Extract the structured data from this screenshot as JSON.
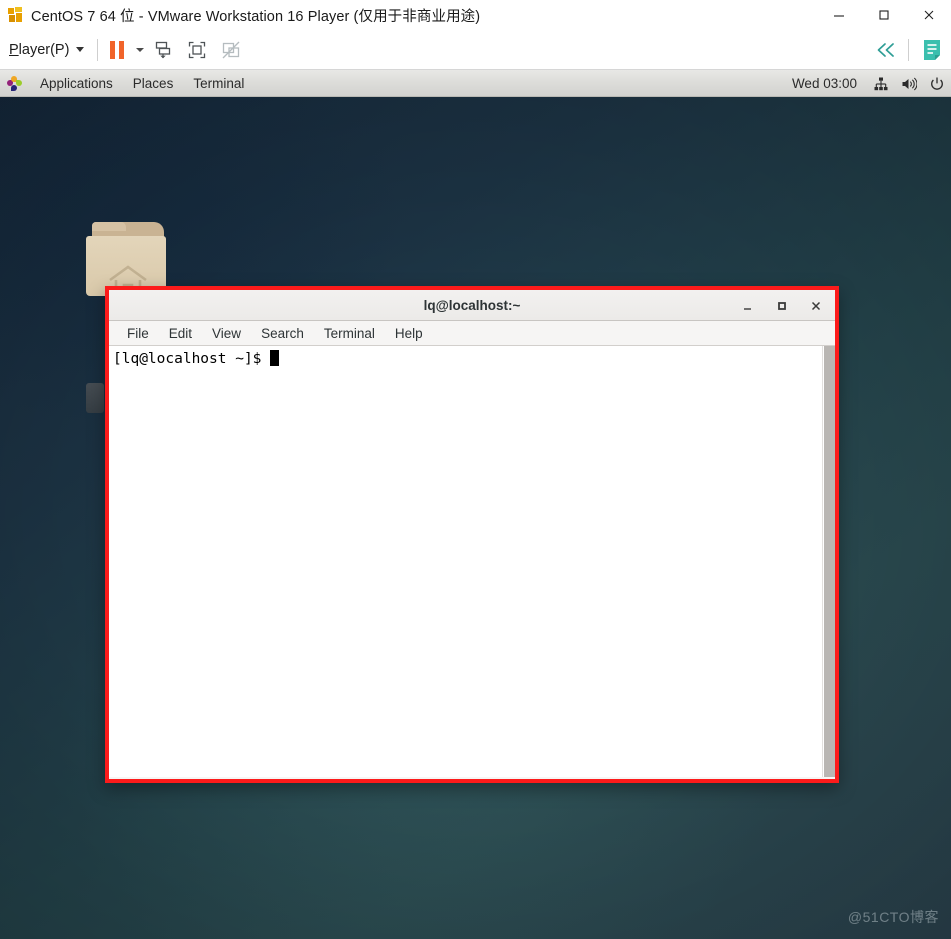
{
  "vmware": {
    "title": "CentOS 7 64 位 - VMware Workstation 16 Player (仅用于非商业用途)",
    "app_icon": "vmware-logo-icon",
    "window_controls": [
      {
        "name": "minimize-button",
        "label": "Minimize",
        "glyph": "minimize-icon"
      },
      {
        "name": "maximize-button",
        "label": "Maximize",
        "glyph": "maximize-icon"
      },
      {
        "name": "close-button",
        "label": "Close",
        "glyph": "close-icon"
      }
    ],
    "toolbar": {
      "player_menu_label": "Player(P)",
      "player_menu_accesskey": "P",
      "pause_button_name": "pause-vm-button",
      "pause_color": "#f1642a",
      "icons": [
        {
          "name": "send-ctrl-alt-del-icon",
          "label": "Send Ctrl+Alt+Del"
        },
        {
          "name": "enter-fullscreen-icon",
          "label": "Enter full screen"
        },
        {
          "name": "unity-mode-disabled-icon",
          "label": "Unity mode (disabled)"
        }
      ],
      "right_icons": [
        {
          "name": "collapse-toolbar-icon",
          "label": "Collapse",
          "color": "#2f9e96"
        },
        {
          "name": "notes-icon",
          "label": "Notes",
          "color": "#3bbfae"
        }
      ]
    }
  },
  "guest": {
    "panel": {
      "logo_icon": "centos-logo-icon",
      "menus": [
        {
          "name": "applications-menu",
          "label": "Applications"
        },
        {
          "name": "places-menu",
          "label": "Places"
        },
        {
          "name": "terminal-window-menu",
          "label": "Terminal"
        }
      ],
      "clock": "Wed 03:00",
      "status_icons": [
        {
          "name": "network-icon",
          "label": "Network"
        },
        {
          "name": "volume-icon",
          "label": "Volume"
        },
        {
          "name": "power-icon",
          "label": "Power / System"
        }
      ]
    },
    "desktop": {
      "icons": [
        {
          "name": "desktop-icon-home",
          "label": "Home folder",
          "color": "#ddcfb1"
        }
      ],
      "watermark": "@51CTO博客",
      "background_colors": [
        "#16293c",
        "#24444c",
        "#2c4450"
      ]
    }
  },
  "terminal": {
    "title": "lq@localhost:~",
    "highlight_border_color": "#fc1b1b",
    "window_controls": [
      {
        "name": "terminal-minimize-button",
        "label": "Minimize"
      },
      {
        "name": "terminal-maximize-button",
        "label": "Maximize"
      },
      {
        "name": "terminal-close-button",
        "label": "Close"
      }
    ],
    "menus": [
      {
        "name": "terminal-menu-file",
        "label": "File"
      },
      {
        "name": "terminal-menu-edit",
        "label": "Edit"
      },
      {
        "name": "terminal-menu-view",
        "label": "View"
      },
      {
        "name": "terminal-menu-search",
        "label": "Search"
      },
      {
        "name": "terminal-menu-terminal",
        "label": "Terminal"
      },
      {
        "name": "terminal-menu-help",
        "label": "Help"
      }
    ],
    "prompt": "[lq@localhost ~]$ ",
    "command": ""
  }
}
